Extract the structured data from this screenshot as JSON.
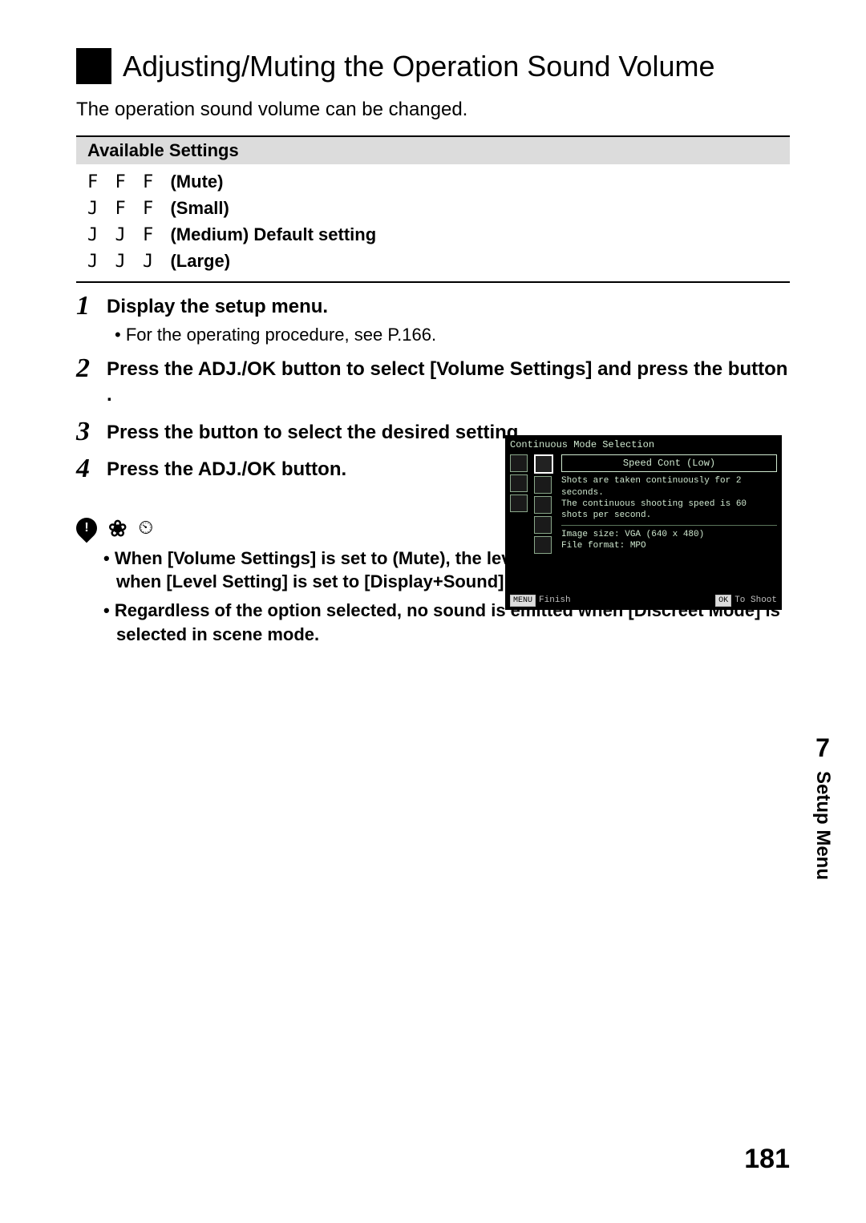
{
  "title": "Adjusting/Muting the Operation Sound Volume",
  "intro": "The operation sound volume can be changed.",
  "settings_header": "Available Settings",
  "settings": [
    {
      "pre": "F F F ",
      "name": "(Mute)",
      "suffix": ""
    },
    {
      "pre": "J F F ",
      "name": "(Small)",
      "suffix": ""
    },
    {
      "pre": "J J F ",
      "name": "(Medium)",
      "suffix": " Default setting"
    },
    {
      "pre": "J J J ",
      "name": "(Large)",
      "suffix": ""
    }
  ],
  "steps": {
    "s1": {
      "head": "Display the setup menu.",
      "sub": "• For the operating procedure, see P.166."
    },
    "s2": {
      "head": "Press the ADJ./OK button      to select [Volume Settings] and press the button    ."
    },
    "s3": {
      "head": "Press the button        to select the desired setting."
    },
    "s4": {
      "head": "Press the ADJ./OK button."
    }
  },
  "screenshot": {
    "title": "Continuous Mode Selection",
    "box": "Speed Cont (Low)",
    "desc1": "Shots are taken continuously for 2 seconds.",
    "desc2": "The continuous shooting speed is 60 shots per second.",
    "desc3": "Image size: VGA (640 x 480)",
    "desc4": "File format: MPO",
    "footer_left_tag": "MENU",
    "footer_left": "Finish",
    "footer_right_tag": "OK",
    "footer_right": "To Shoot"
  },
  "notes": [
    "When [Volume Settings] is set to (Mute), the level sound is not emitted even when [Level Setting] is set to [Display+Sound] or [Sound]. (P.187)",
    "Regardless of the option selected, no sound is emitted when [Discreet Mode] is selected in scene mode."
  ],
  "side": {
    "num": "7",
    "label": "Setup Menu"
  },
  "page_number": "181"
}
